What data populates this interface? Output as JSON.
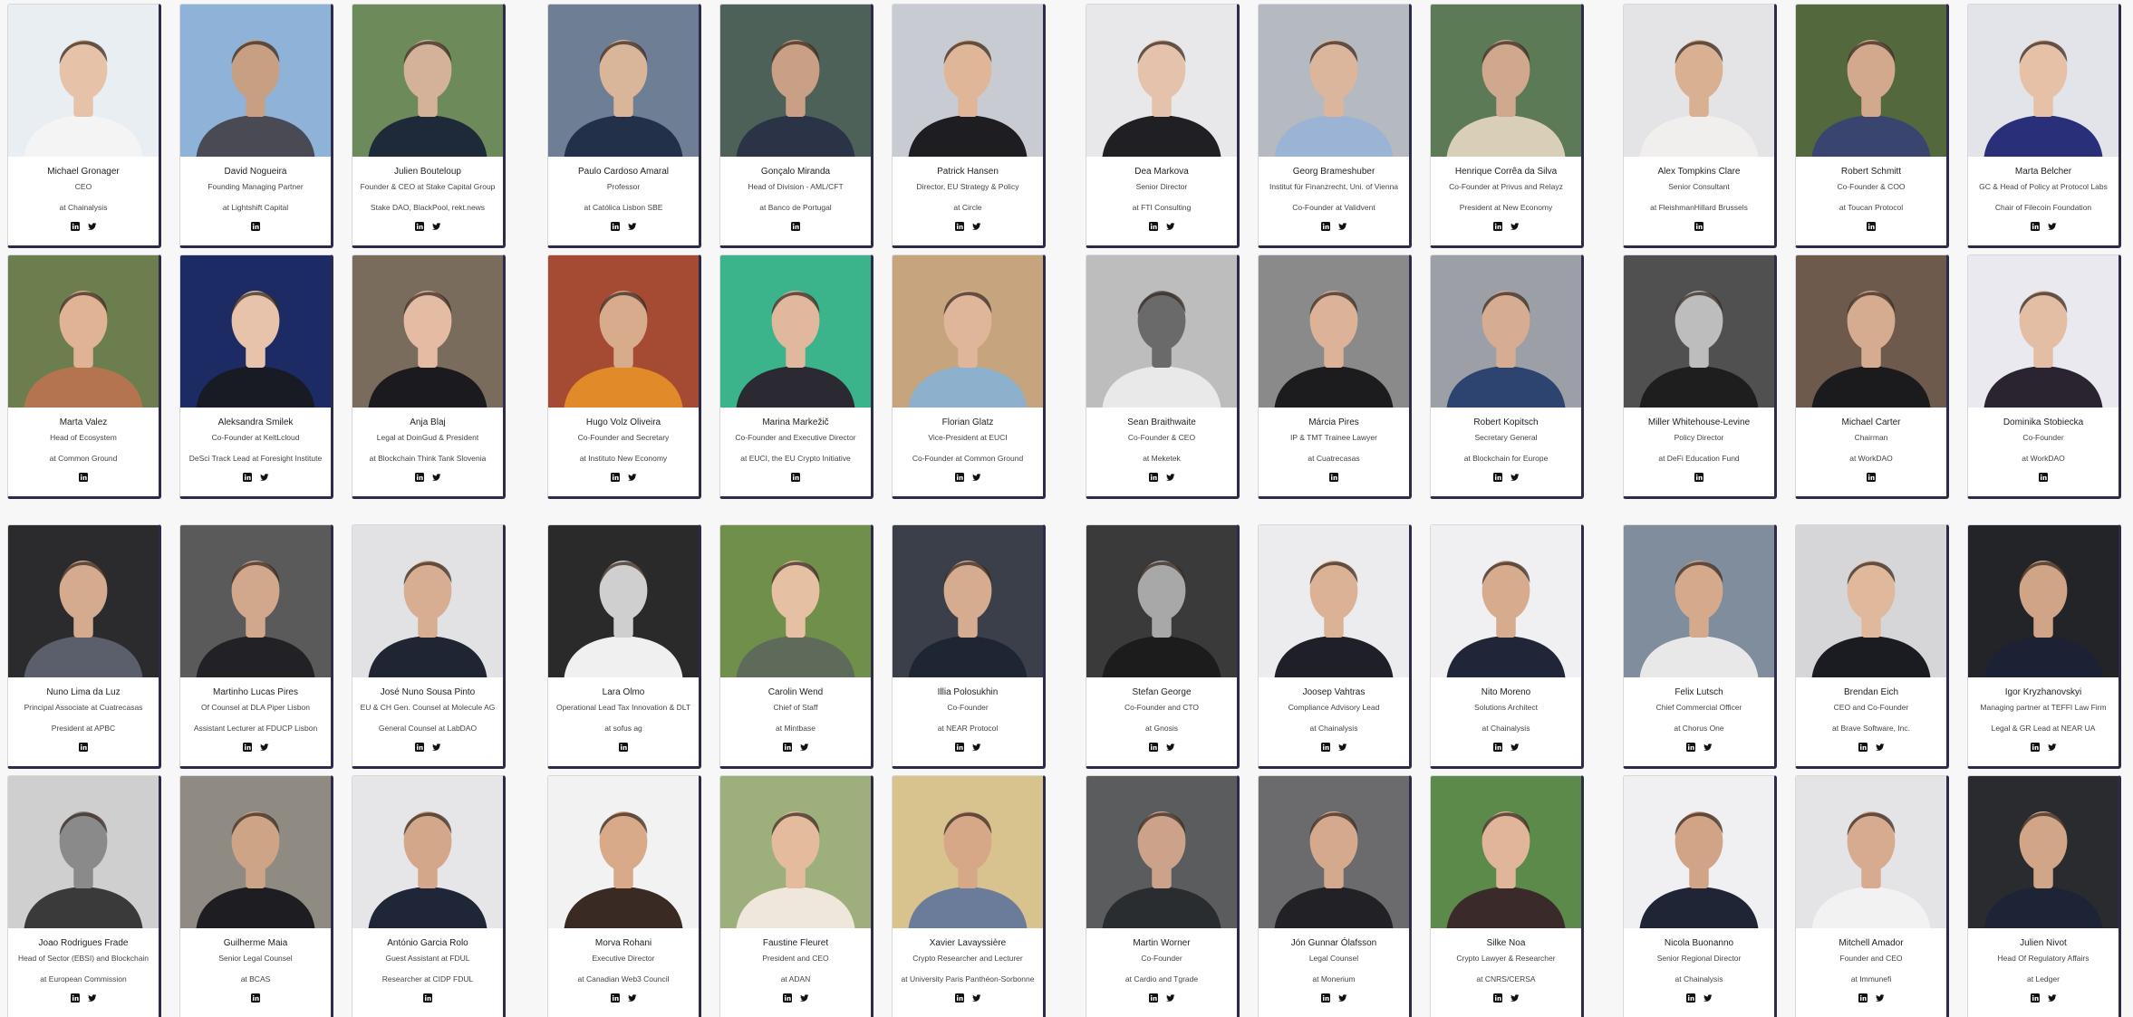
{
  "colors": {
    "card_border_accent": "#2e2a4a",
    "background": "#f7f7f8",
    "text": "#222222"
  },
  "icons": {
    "linkedin": "linkedin-icon",
    "twitter": "twitter-icon"
  },
  "speakers": [
    {
      "name": "Michael Gronager",
      "role": "CEO",
      "org": "at Chainalysis",
      "socials": [
        "linkedin",
        "twitter"
      ],
      "palette": [
        "#e9eef2",
        "#e6c3a8",
        "#f4f4f4"
      ]
    },
    {
      "name": "David Nogueira",
      "role": "Founding Managing Partner",
      "org": "at Lightshift Capital",
      "socials": [
        "linkedin"
      ],
      "palette": [
        "#8fb2d8",
        "#c79f83",
        "#4a4a55"
      ]
    },
    {
      "name": "Julien Bouteloup",
      "role": "Founder & CEO at Stake Capital Group",
      "org": "Stake DAO, BlackPool, rekt.news",
      "socials": [
        "linkedin",
        "twitter"
      ],
      "palette": [
        "#6d8a5a",
        "#d4b29a",
        "#1e2a3a"
      ]
    },
    {
      "name": "Paulo Cardoso Amaral",
      "role": "Professor",
      "org": "at Católica Lisbon SBE",
      "socials": [
        "linkedin",
        "twitter"
      ],
      "palette": [
        "#6e7f95",
        "#d9b59a",
        "#22304a"
      ]
    },
    {
      "name": "Gonçalo Miranda",
      "role": "Head of Division - AML/CFT",
      "org": "at Banco de Portugal",
      "socials": [
        "linkedin"
      ],
      "palette": [
        "#4d6158",
        "#c99f85",
        "#2a3446"
      ]
    },
    {
      "name": "Patrick Hansen",
      "role": "Director, EU Strategy & Policy",
      "org": "at Circle",
      "socials": [
        "linkedin",
        "twitter"
      ],
      "palette": [
        "#c8ccd2",
        "#e0b698",
        "#1d1d22"
      ]
    },
    {
      "name": "Dea Markova",
      "role": "Senior Director",
      "org": "at FTI Consulting",
      "socials": [
        "linkedin",
        "twitter"
      ],
      "palette": [
        "#e8e8ea",
        "#e5c2ac",
        "#1f1f24"
      ]
    },
    {
      "name": "Georg Brameshuber",
      "role": "Institut für Finanzrecht, Uni. of Vienna",
      "org": "Co-Founder at Validvent",
      "socials": [
        "linkedin",
        "twitter"
      ],
      "palette": [
        "#b5b9c0",
        "#dcb69c",
        "#9bb3d4"
      ]
    },
    {
      "name": "Henrique Corrêa da Silva",
      "role": "Co-Founder at Privus and Relayz",
      "org": "President at New Economy",
      "socials": [
        "linkedin",
        "twitter"
      ],
      "palette": [
        "#5d7a56",
        "#d0a88e",
        "#d9cfb8"
      ]
    },
    {
      "name": "Alex Tompkins Clare",
      "role": "Senior Consultant",
      "org": "at FleishmanHillard Brussels",
      "socials": [
        "linkedin"
      ],
      "palette": [
        "#e4e4e6",
        "#dab092",
        "#f0efee"
      ]
    },
    {
      "name": "Robert Schmitt",
      "role": "Co-Founder & COO",
      "org": "at Toucan Protocol",
      "socials": [
        "linkedin"
      ],
      "palette": [
        "#53683c",
        "#d3a98d",
        "#39456e"
      ]
    },
    {
      "name": "Marta Belcher",
      "role": "GC & Head of Policy at Protocol Labs",
      "org": "Chair of Filecoin Foundation",
      "socials": [
        "linkedin",
        "twitter"
      ],
      "palette": [
        "#e3e3ea",
        "#e6c1a8",
        "#2a2f7a"
      ]
    },
    {
      "name": "Marta Valez",
      "role": "Head of Ecosystem",
      "org": "at Common Ground",
      "socials": [
        "linkedin"
      ],
      "palette": [
        "#6d7e4e",
        "#e0b394",
        "#b57450"
      ]
    },
    {
      "name": "Aleksandra Smilek",
      "role": "Co-Founder at KeltLcloud",
      "org": "DeSci Track Lead at Foresight Institute",
      "socials": [
        "linkedin",
        "twitter"
      ],
      "palette": [
        "#1c2b63",
        "#e7c3ab",
        "#181a24"
      ]
    },
    {
      "name": "Anja Blaj",
      "role": "Legal at DoinGud & President",
      "org": "at Blockchain Think Tank Slovenia",
      "socials": [
        "linkedin",
        "twitter"
      ],
      "palette": [
        "#7a6c5c",
        "#e3bca3",
        "#1b1b1f"
      ]
    },
    {
      "name": "Hugo Volz Oliveira",
      "role": "Co-Founder and Secretary",
      "org": "at Instituto New Economy",
      "socials": [
        "linkedin",
        "twitter"
      ],
      "palette": [
        "#a54a33",
        "#d8ab8d",
        "#e08a2a"
      ]
    },
    {
      "name": "Marina Markežič",
      "role": "Co-Founder and Executive Director",
      "org": "at EUCI, the EU Crypto Initiative",
      "socials": [
        "linkedin"
      ],
      "palette": [
        "#3cb48b",
        "#e0b89e",
        "#2b2a33"
      ]
    },
    {
      "name": "Florian Glatz",
      "role": "Vice-President at EUCI",
      "org": "Co-Founder at Common Ground",
      "socials": [
        "linkedin",
        "twitter"
      ],
      "palette": [
        "#c5a47e",
        "#dfb69a",
        "#8db1cc"
      ]
    },
    {
      "name": "Sean Braithwaite",
      "role": "Co-Founder & CEO",
      "org": "at Meketek",
      "socials": [
        "linkedin",
        "twitter"
      ],
      "palette": [
        "#bdbdbd",
        "#6a6a6a",
        "#e9e9e9"
      ]
    },
    {
      "name": "Márcia Pires",
      "role": "IP & TMT Trainee Lawyer",
      "org": "at Cuatrecasas",
      "socials": [
        "linkedin"
      ],
      "palette": [
        "#8a8a8a",
        "#dcb298",
        "#1c1c1f"
      ]
    },
    {
      "name": "Robert Kopitsch",
      "role": "Secretary General",
      "org": "at Blockchain for Europe",
      "socials": [
        "linkedin",
        "twitter"
      ],
      "palette": [
        "#9c9fa6",
        "#d6ad93",
        "#2d4470"
      ]
    },
    {
      "name": "Miller Whitehouse-Levine",
      "role": "Policy Director",
      "org": "at DeFi Education Fund",
      "socials": [
        "linkedin"
      ],
      "palette": [
        "#505050",
        "#bdbdbd",
        "#1e1e1e"
      ]
    },
    {
      "name": "Michael Carter",
      "role": "Chairman",
      "org": "at WorkDAO",
      "socials": [
        "linkedin"
      ],
      "palette": [
        "#6e5a4c",
        "#d5ac90",
        "#1b1b1e"
      ]
    },
    {
      "name": "Dominika Stobiecka",
      "role": "Co-Founder",
      "org": "at WorkDAO",
      "socials": [
        "linkedin"
      ],
      "palette": [
        "#e9e9ef",
        "#e3bea5",
        "#2a2430"
      ]
    },
    {
      "name": "Nuno Lima da Luz",
      "role": "Principal Associate at Cuatrecasas",
      "org": "President at APBC",
      "socials": [
        "linkedin"
      ],
      "palette": [
        "#2b2b2e",
        "#d5ab8f",
        "#5a5f6b"
      ]
    },
    {
      "name": "Martinho Lucas Pires",
      "role": "Of Counsel at DLA Piper Lisbon",
      "org": "Assistant Lecturer at FDUCP Lisbon",
      "socials": [
        "linkedin",
        "twitter"
      ],
      "palette": [
        "#5a5a5a",
        "#d2a88c",
        "#222226"
      ]
    },
    {
      "name": "José Nuno Sousa Pinto",
      "role": "EU & CH Gen. Counsel at Molecule AG",
      "org": "General Counsel at LabDAO",
      "socials": [
        "linkedin",
        "twitter"
      ],
      "palette": [
        "#e2e2e4",
        "#d8ae92",
        "#1f2533"
      ]
    },
    {
      "name": "Lara Olmo",
      "role": "Operational Lead Tax Innovation & DLT",
      "org": "at sofus ag",
      "socials": [
        "linkedin"
      ],
      "palette": [
        "#2a2a2a",
        "#cfcfcf",
        "#f0f0f0"
      ]
    },
    {
      "name": "Carolin Wend",
      "role": "Chief of Staff",
      "org": "at Mintbase",
      "socials": [
        "linkedin",
        "twitter"
      ],
      "palette": [
        "#6f8f4a",
        "#e6c0a2",
        "#5f6b5a"
      ]
    },
    {
      "name": "Illia Polosukhin",
      "role": "Co-Founder",
      "org": "at NEAR Protocol",
      "socials": [
        "linkedin",
        "twitter"
      ],
      "palette": [
        "#3b3f4a",
        "#d6ac91",
        "#1e2633"
      ]
    },
    {
      "name": "Stefan George",
      "role": "Co-Founder and CTO",
      "org": "at Gnosis",
      "socials": [
        "linkedin",
        "twitter"
      ],
      "palette": [
        "#3a3a3a",
        "#a8a8a8",
        "#1c1c1c"
      ]
    },
    {
      "name": "Joosep Vahtras",
      "role": "Compliance Advisory Lead",
      "org": "at Chainalysis",
      "socials": [
        "linkedin",
        "twitter"
      ],
      "palette": [
        "#ececee",
        "#dcb296",
        "#1e1f28"
      ]
    },
    {
      "name": "Nito Moreno",
      "role": "Solutions Architect",
      "org": "at Chainalysis",
      "socials": [
        "linkedin",
        "twitter"
      ],
      "palette": [
        "#f0f0f2",
        "#d6ab8e",
        "#202638"
      ]
    },
    {
      "name": "Felix Lutsch",
      "role": "Chief Commercial Officer",
      "org": "at Chorus One",
      "socials": [
        "linkedin",
        "twitter"
      ],
      "palette": [
        "#7f8d9c",
        "#d4a98c",
        "#e8e8e8"
      ]
    },
    {
      "name": "Brendan Eich",
      "role": "CEO and Co-Founder",
      "org": "at Brave Software, Inc.",
      "socials": [
        "linkedin",
        "twitter"
      ],
      "palette": [
        "#d6d6d8",
        "#e0b89c",
        "#1b1c22"
      ]
    },
    {
      "name": "Igor Kryzhanovskyi",
      "role": "Managing partner at TEFFI Law Firm",
      "org": "Legal & GR Lead at NEAR UA",
      "socials": [
        "linkedin",
        "twitter"
      ],
      "palette": [
        "#232428",
        "#cfa487",
        "#1c2233"
      ]
    },
    {
      "name": "Joao Rodrigues Frade",
      "role": "Head of Sector (EBSI) and Blockchain",
      "org": "at European Commission",
      "socials": [
        "linkedin",
        "twitter"
      ],
      "palette": [
        "#cfcfcf",
        "#8a8a8a",
        "#3a3a3a"
      ]
    },
    {
      "name": "Guilherme Maia",
      "role": "Senior Legal Counsel",
      "org": "at BCAS",
      "socials": [
        "linkedin"
      ],
      "palette": [
        "#8f8a82",
        "#cea487",
        "#1e1e22"
      ]
    },
    {
      "name": "António Garcia Rolo",
      "role": "Guest Assistant at FDUL",
      "org": "Researcher at CIDP FDUL",
      "socials": [
        "linkedin"
      ],
      "palette": [
        "#e6e6e8",
        "#d2a78a",
        "#1f2638"
      ]
    },
    {
      "name": "Morva Rohani",
      "role": "Executive Director",
      "org": "at Canadian Web3 Council",
      "socials": [
        "linkedin",
        "twitter"
      ],
      "palette": [
        "#f2f2f2",
        "#d8aa8a",
        "#3a2a24"
      ]
    },
    {
      "name": "Faustine Fleuret",
      "role": "President and CEO",
      "org": "at ADAN",
      "socials": [
        "linkedin",
        "twitter"
      ],
      "palette": [
        "#9db07c",
        "#e4bb9c",
        "#efe6dc"
      ]
    },
    {
      "name": "Xavier Lavayssière",
      "role": "Crypto Researcher and Lecturer",
      "org": "at University Paris Panthéon-Sorbonne",
      "socials": [
        "linkedin",
        "twitter"
      ],
      "palette": [
        "#d8c28e",
        "#d6a887",
        "#6a7c99"
      ]
    },
    {
      "name": "Martin Worner",
      "role": "Co-Founder",
      "org": "at Cardio and Tgrade",
      "socials": [
        "linkedin",
        "twitter"
      ],
      "palette": [
        "#5a5c5e",
        "#cda28a",
        "#2a2d30"
      ]
    },
    {
      "name": "Jón Gunnar Ólafsson",
      "role": "Legal Counsel",
      "org": "at Monerium",
      "socials": [
        "linkedin",
        "twitter"
      ],
      "palette": [
        "#6b6b6d",
        "#d4a98e",
        "#222226"
      ]
    },
    {
      "name": "Silke Noa",
      "role": "Crypto Lawyer & Researcher",
      "org": "at CNRS/CERSA",
      "socials": [
        "linkedin",
        "twitter"
      ],
      "palette": [
        "#5b8a4a",
        "#e0b599",
        "#3b2a2a"
      ]
    },
    {
      "name": "Nicola Buonanno",
      "role": "Senior Regional Director",
      "org": "at Chainalysis",
      "socials": [
        "linkedin",
        "twitter"
      ],
      "palette": [
        "#f0f0f2",
        "#d1a488",
        "#1f2535"
      ]
    },
    {
      "name": "Mitchell Amador",
      "role": "Founder and CEO",
      "org": "at Immunefi",
      "socials": [
        "linkedin",
        "twitter"
      ],
      "palette": [
        "#e4e4e6",
        "#d6ab8f",
        "#f2f2f2"
      ]
    },
    {
      "name": "Julien Nivot",
      "role": "Head Of Regulatory Affairs",
      "org": "at Ledger",
      "socials": [
        "linkedin",
        "twitter"
      ],
      "palette": [
        "#2a2b2f",
        "#d0a588",
        "#1d2435"
      ]
    }
  ]
}
